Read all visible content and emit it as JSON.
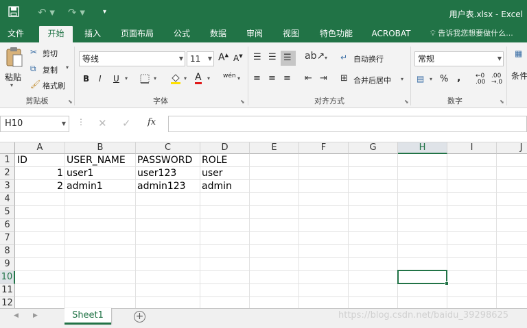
{
  "titlebar": {
    "title": "用户表.xlsx - Excel"
  },
  "tabs": [
    "文件",
    "开始",
    "插入",
    "页面布局",
    "公式",
    "数据",
    "审阅",
    "视图",
    "特色功能",
    "ACROBAT"
  ],
  "tell_me": "告诉我您想要做什么...",
  "clipboard": {
    "paste": "粘贴",
    "cut": "剪切",
    "copy": "复制",
    "format_painter": "格式刷",
    "group": "剪贴板"
  },
  "font": {
    "name": "等线",
    "size": "11",
    "group": "字体",
    "bold": "B",
    "italic": "I",
    "underline": "U",
    "grow": "A",
    "shrink": "A",
    "font_color_glyph": "A",
    "phonetic": "wén"
  },
  "alignment": {
    "wrap": "自动换行",
    "merge": "合并后居中",
    "group": "对齐方式"
  },
  "number": {
    "format": "常规",
    "percent": "%",
    "comma": ",",
    "group": "数字",
    "inc": ".00",
    "dec": ".0"
  },
  "styles": {
    "cond": "条件"
  },
  "formula_bar": {
    "name_box": "H10",
    "fx": "fx"
  },
  "sheet": {
    "columns": [
      "A",
      "B",
      "C",
      "D",
      "E",
      "F",
      "G",
      "H",
      "I",
      "J"
    ],
    "rows": [
      "1",
      "2",
      "3",
      "4",
      "5",
      "6",
      "7",
      "8",
      "9",
      "10",
      "11",
      "12"
    ],
    "cells": {
      "r1": {
        "A": "ID",
        "B": "USER_NAME",
        "C": "PASSWORD",
        "D": "ROLE"
      },
      "r2": {
        "A": "1",
        "B": "user1",
        "C": "user123",
        "D": "user"
      },
      "r3": {
        "A": "2",
        "B": "admin1",
        "C": "admin123",
        "D": "admin"
      }
    },
    "selected_cell": "H10"
  },
  "sheet_tabs": [
    "Sheet1"
  ],
  "watermark": "https://blog.csdn.net/baidu_39298625"
}
